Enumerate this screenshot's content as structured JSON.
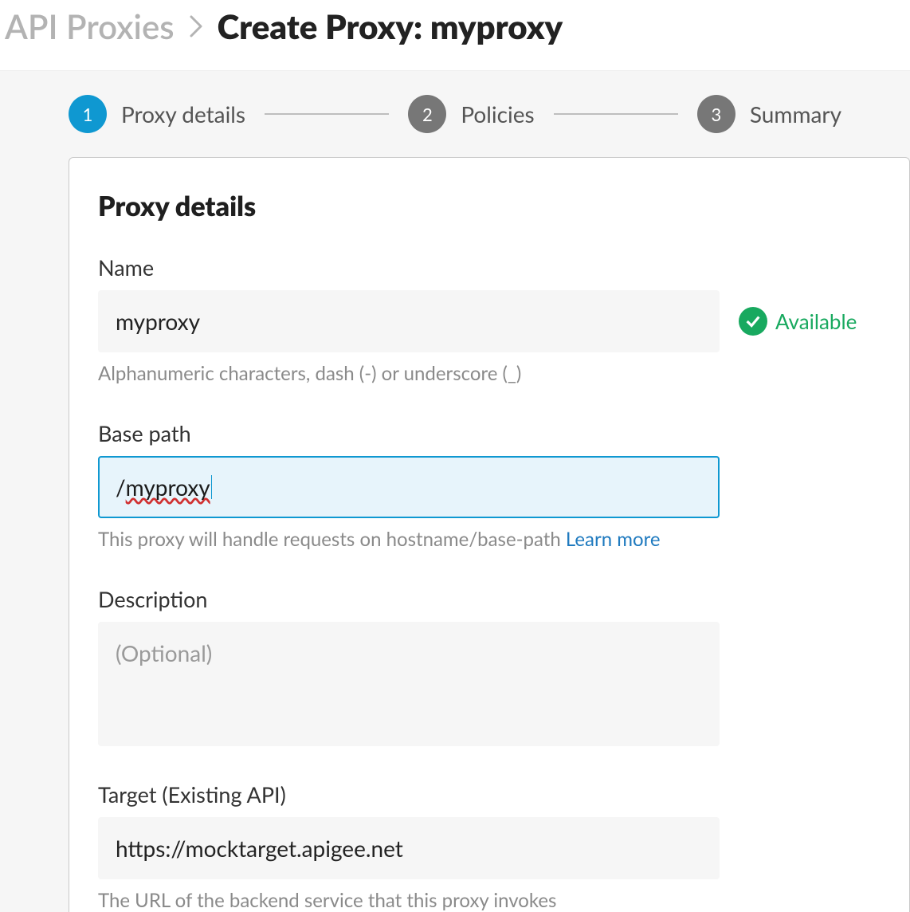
{
  "breadcrumb": {
    "prev": "API Proxies",
    "current": "Create Proxy: myproxy"
  },
  "stepper": {
    "steps": [
      {
        "num": "1",
        "label": "Proxy details",
        "active": true
      },
      {
        "num": "2",
        "label": "Policies",
        "active": false
      },
      {
        "num": "3",
        "label": "Summary",
        "active": false
      }
    ]
  },
  "panel": {
    "title": "Proxy details",
    "name": {
      "label": "Name",
      "value": "myproxy",
      "hint": "Alphanumeric characters, dash (-) or underscore (_)",
      "status": "Available"
    },
    "basepath": {
      "label": "Base path",
      "value": "/myproxy",
      "hint_prefix": "This proxy will handle requests on hostname/base-path ",
      "learn_more": "Learn more"
    },
    "description": {
      "label": "Description",
      "placeholder": "(Optional)",
      "value": ""
    },
    "target": {
      "label": "Target (Existing API)",
      "value": "https://mocktarget.apigee.net",
      "hint": "The URL of the backend service that this proxy invokes"
    }
  }
}
